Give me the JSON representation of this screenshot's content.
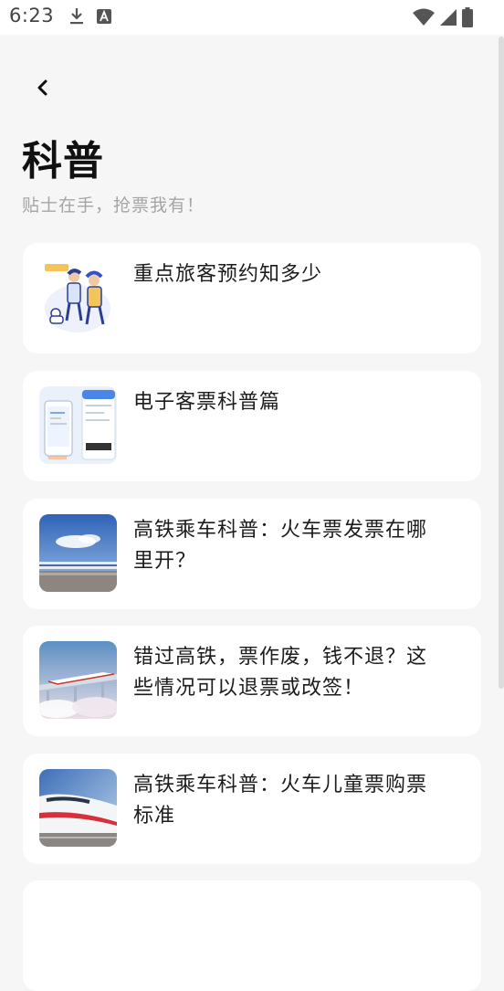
{
  "status_bar": {
    "time": "6:23",
    "left_icons": [
      "download-icon",
      "keyboard-a-icon"
    ],
    "right_icons": [
      "wifi-icon",
      "signal-icon",
      "battery-icon"
    ]
  },
  "header": {
    "back_icon": "chevron-left-icon",
    "title": "科普",
    "subtitle": "贴士在手，抢票我有！"
  },
  "articles": [
    {
      "title": "重点旅客预约知多少",
      "thumb": "illustration-travelers"
    },
    {
      "title": "电子客票科普篇",
      "thumb": "phone-e-ticket"
    },
    {
      "title": "高铁乘车科普：火车票发票在哪里开？",
      "thumb": "bullet-train-sky"
    },
    {
      "title": "错过高铁，票作废，钱不退？这些情况可以退票或改签！",
      "thumb": "train-on-bridge"
    },
    {
      "title": "高铁乘车科普：火车儿童票购票标准",
      "thumb": "white-bullet-train"
    }
  ],
  "colors": {
    "background": "#f6f6f7",
    "card": "#ffffff",
    "subtitle": "#a5a5a8"
  }
}
